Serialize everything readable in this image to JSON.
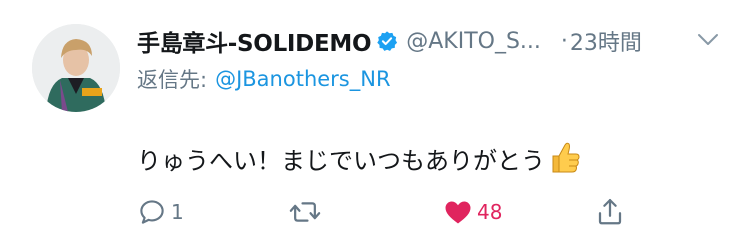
{
  "tweet": {
    "author_name": "手島章斗-SOLIDEMO",
    "handle": "@AKITO_S...",
    "separator": "·",
    "time": "23時間",
    "reply_prefix": "返信先:",
    "reply_to": "@JBanothers_NR",
    "text": "りゅうへい！まじでいつもありがとう",
    "text_emoji": "thumbs-up"
  },
  "actions": {
    "reply_count": "1",
    "retweet_count": "",
    "like_count": "48"
  },
  "colors": {
    "accent": "#1b95e0",
    "like": "#e0245e",
    "muted": "#657786",
    "text": "#14171a",
    "verified": "#1da1f2"
  },
  "icons": [
    "verified-badge-icon",
    "chevron-down-icon",
    "reply-icon",
    "retweet-icon",
    "heart-icon",
    "share-icon",
    "thumbs-up-icon"
  ]
}
